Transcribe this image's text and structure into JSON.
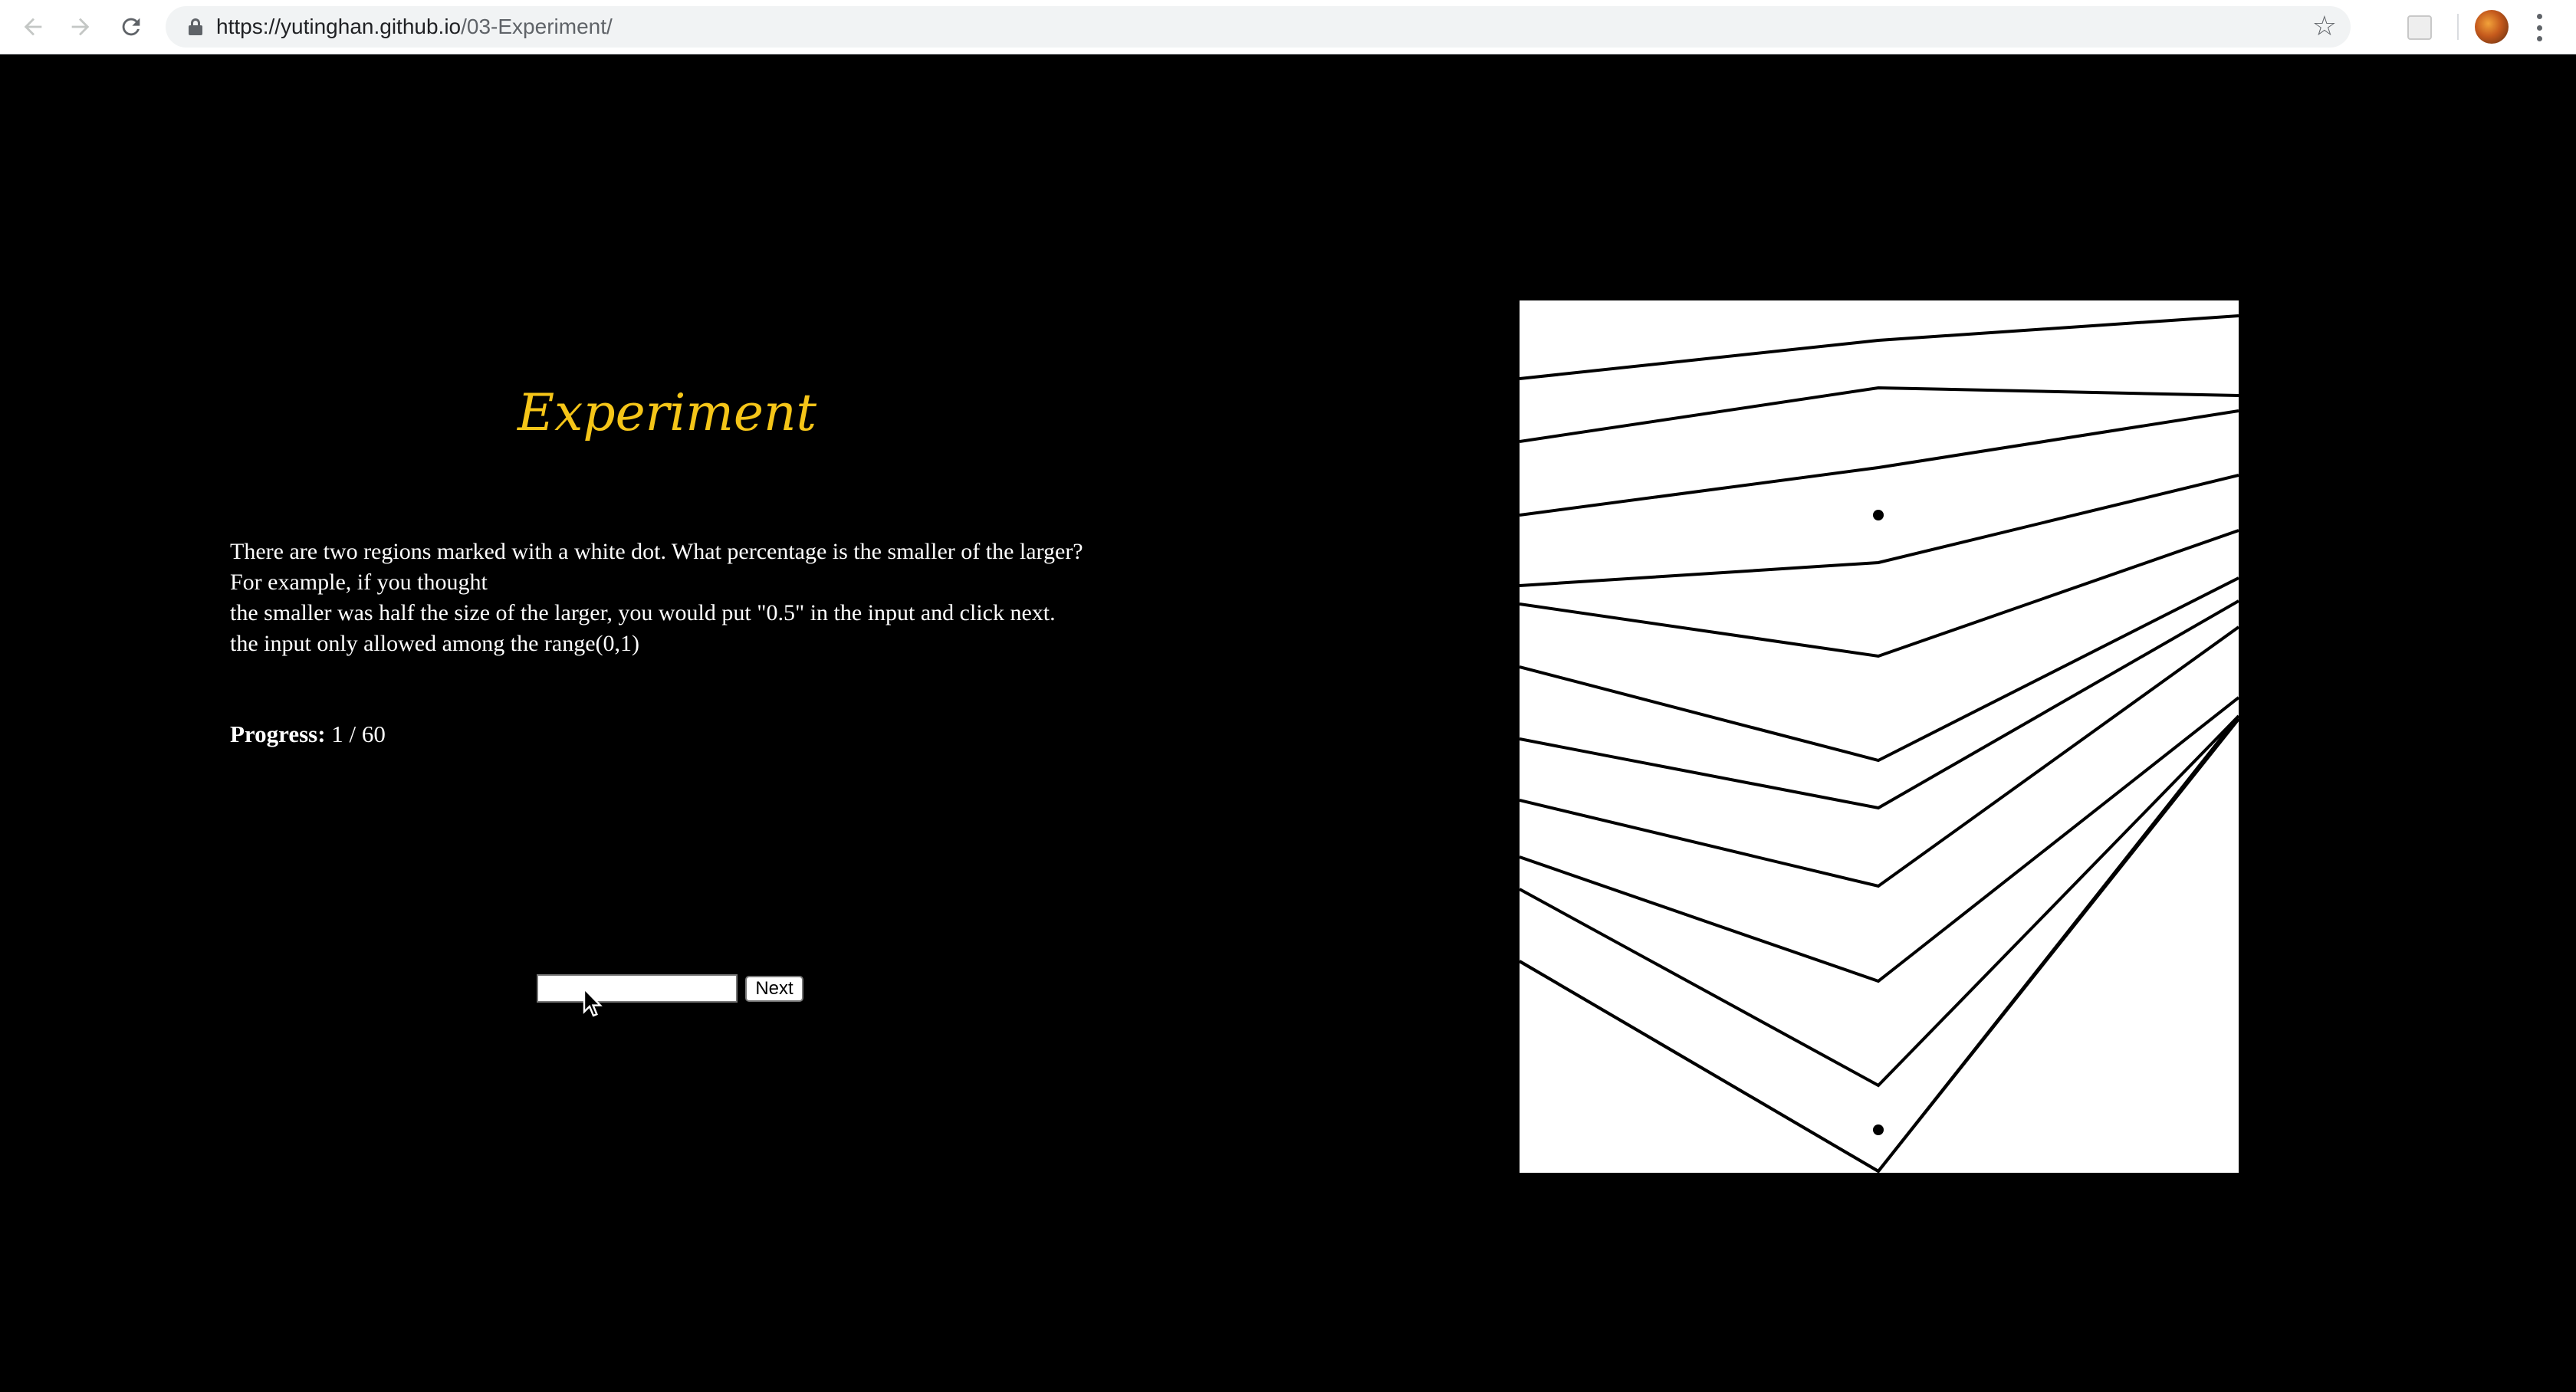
{
  "browser": {
    "url_host": "https://yutinghan.github.io",
    "url_path": "/03-Experiment/",
    "icons": [
      "back-arrow-icon",
      "forward-arrow-icon",
      "reload-icon",
      "lock-icon",
      "bookmark-star-icon",
      "extension-icon",
      "profile-avatar",
      "menu-dots-icon"
    ]
  },
  "page": {
    "title": "Experiment",
    "instructions": [
      "There are two regions marked with a white dot. What percentage is the smaller of the larger?",
      "For example, if you thought",
      "the smaller was half the size of the larger, you would put \"0.5\" in the input and click next.",
      "the input only allowed among the range(0,1)"
    ],
    "progress_label": "Progress:",
    "progress_value": "1 / 60",
    "input_value": "",
    "input_placeholder": "",
    "next_label": "Next"
  },
  "colors": {
    "background": "#000000",
    "title": "#f5c518",
    "text": "#ffffff",
    "chart_bg": "#ffffff",
    "chart_line": "#000000"
  }
}
